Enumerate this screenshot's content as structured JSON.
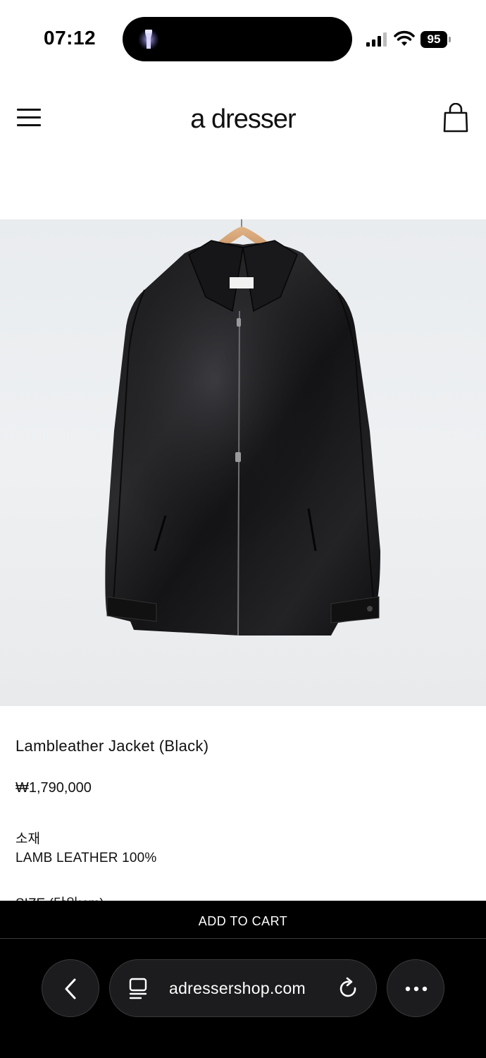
{
  "status_bar": {
    "time": "07:12",
    "battery": "95",
    "icons": [
      "flashlight-icon",
      "signal-icon",
      "wifi-icon",
      "battery-icon"
    ]
  },
  "header": {
    "brand": "a dresser",
    "icons": [
      "menu-icon",
      "shopping-bag-icon"
    ]
  },
  "product": {
    "image": "black-leather-jacket-on-hanger",
    "title": "Lambleather Jacket (Black)",
    "price": "₩1,790,000",
    "material_label": "소재",
    "material_value": "LAMB LEATHER 100%",
    "size_label": "SIZE (단위:cm)"
  },
  "cart": {
    "add_label": "ADD TO CART"
  },
  "browser": {
    "url": "adressershop.com",
    "icons": [
      "back-chevron-icon",
      "reader-icon",
      "reload-icon",
      "more-icon"
    ]
  },
  "colors": {
    "cart_bar": "#000000",
    "toolbar_bg": "#000000",
    "pill_bg": "#1c1c1e",
    "image_bg": "#eceef0"
  }
}
